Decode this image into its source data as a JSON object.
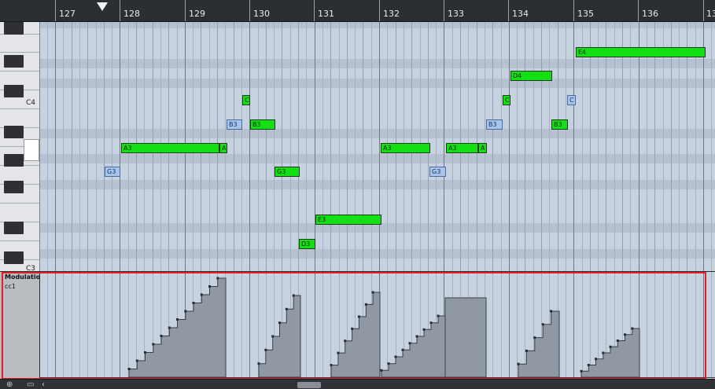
{
  "ruler": {
    "bars": [
      {
        "label": "127"
      },
      {
        "label": "128"
      },
      {
        "label": "129"
      },
      {
        "label": "130"
      },
      {
        "label": "131"
      },
      {
        "label": "132"
      },
      {
        "label": "133"
      },
      {
        "label": "134"
      },
      {
        "label": "135"
      },
      {
        "label": "136"
      },
      {
        "label": "13"
      }
    ]
  },
  "keyboard": {
    "labels": [
      "C4",
      "C3"
    ]
  },
  "notes": [
    {
      "label": "A3"
    },
    {
      "label": "A"
    },
    {
      "label": "G3"
    },
    {
      "label": "B3"
    },
    {
      "label": "C"
    },
    {
      "label": "B3"
    },
    {
      "label": "G3"
    },
    {
      "label": "D3"
    },
    {
      "label": "E3"
    },
    {
      "label": "A3"
    },
    {
      "label": "G3"
    },
    {
      "label": "A3"
    },
    {
      "label": "A"
    },
    {
      "label": "B3"
    },
    {
      "label": "C"
    },
    {
      "label": "D4"
    },
    {
      "label": "B3"
    },
    {
      "label": "C"
    },
    {
      "label": "E4"
    }
  ],
  "controller": {
    "title": "Modulatio",
    "subtitle": "cc1"
  },
  "colors": {
    "note_green": "#12e012",
    "note_blue": "#a7c4ec",
    "selection_frame": "#e01e25"
  },
  "icons": [
    "add-lane-icon",
    "lane-preset-icon",
    "scroll-left-icon"
  ]
}
